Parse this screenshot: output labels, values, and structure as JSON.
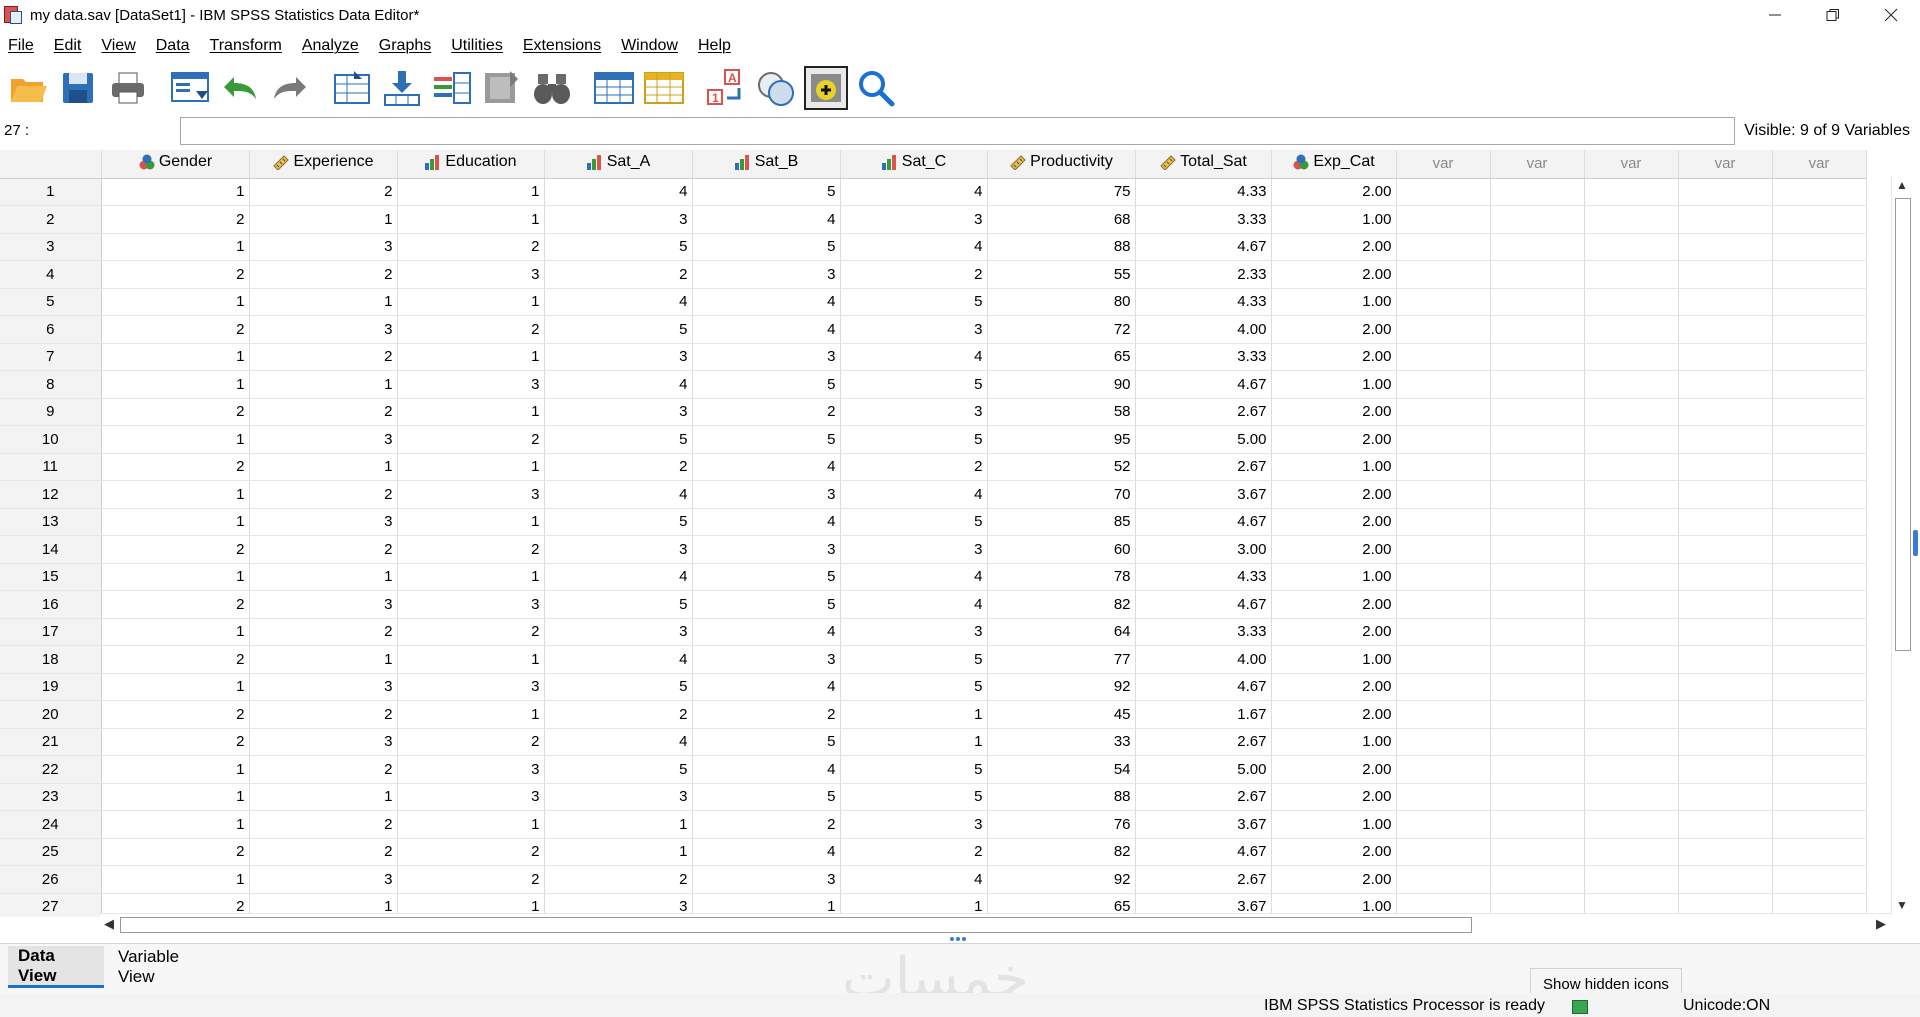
{
  "window": {
    "title": "my data.sav [DataSet1] - IBM SPSS Statistics Data Editor*",
    "controls": [
      "minimize",
      "restore",
      "close"
    ]
  },
  "menu": [
    "File",
    "Edit",
    "View",
    "Data",
    "Transform",
    "Analyze",
    "Graphs",
    "Utilities",
    "Extensions",
    "Window",
    "Help"
  ],
  "toolbar": {
    "buttons": [
      {
        "name": "open-icon"
      },
      {
        "name": "save-icon"
      },
      {
        "name": "print-icon"
      },
      {
        "name": "recall-dialog-icon"
      },
      {
        "name": "undo-icon"
      },
      {
        "name": "redo-icon"
      },
      {
        "name": "goto-case-icon"
      },
      {
        "name": "goto-variable-icon"
      },
      {
        "name": "variables-icon"
      },
      {
        "name": "run-descriptives-icon"
      },
      {
        "name": "find-icon"
      },
      {
        "name": "insert-cases-icon"
      },
      {
        "name": "insert-variable-icon"
      },
      {
        "name": "value-labels-icon"
      },
      {
        "name": "use-variable-sets-icon"
      },
      {
        "name": "show-all-variables-icon"
      },
      {
        "name": "spelling-icon"
      }
    ]
  },
  "cell_editor": {
    "ref": "27 :",
    "value": ""
  },
  "visible_info": "Visible: 9 of 9 Variables",
  "columns": [
    {
      "name": "Gender",
      "type": "nominal"
    },
    {
      "name": "Experience",
      "type": "scale"
    },
    {
      "name": "Education",
      "type": "ordinal"
    },
    {
      "name": "Sat_A",
      "type": "ordinal"
    },
    {
      "name": "Sat_B",
      "type": "ordinal"
    },
    {
      "name": "Sat_C",
      "type": "ordinal"
    },
    {
      "name": "Productivity",
      "type": "scale"
    },
    {
      "name": "Total_Sat",
      "type": "scale"
    },
    {
      "name": "Exp_Cat",
      "type": "nominal"
    }
  ],
  "empty_columns": [
    "var",
    "var",
    "var",
    "var",
    "var"
  ],
  "rows": [
    [
      "1",
      "1",
      "2",
      "1",
      "4",
      "5",
      "4",
      "75",
      "4.33",
      "2.00"
    ],
    [
      "2",
      "2",
      "1",
      "1",
      "3",
      "4",
      "3",
      "68",
      "3.33",
      "1.00"
    ],
    [
      "3",
      "1",
      "3",
      "2",
      "5",
      "5",
      "4",
      "88",
      "4.67",
      "2.00"
    ],
    [
      "4",
      "2",
      "2",
      "3",
      "2",
      "3",
      "2",
      "55",
      "2.33",
      "2.00"
    ],
    [
      "5",
      "1",
      "1",
      "1",
      "4",
      "4",
      "5",
      "80",
      "4.33",
      "1.00"
    ],
    [
      "6",
      "2",
      "3",
      "2",
      "5",
      "4",
      "3",
      "72",
      "4.00",
      "2.00"
    ],
    [
      "7",
      "1",
      "2",
      "1",
      "3",
      "3",
      "4",
      "65",
      "3.33",
      "2.00"
    ],
    [
      "8",
      "1",
      "1",
      "3",
      "4",
      "5",
      "5",
      "90",
      "4.67",
      "1.00"
    ],
    [
      "9",
      "2",
      "2",
      "1",
      "3",
      "2",
      "3",
      "58",
      "2.67",
      "2.00"
    ],
    [
      "10",
      "1",
      "3",
      "2",
      "5",
      "5",
      "5",
      "95",
      "5.00",
      "2.00"
    ],
    [
      "11",
      "2",
      "1",
      "1",
      "2",
      "4",
      "2",
      "52",
      "2.67",
      "1.00"
    ],
    [
      "12",
      "1",
      "2",
      "3",
      "4",
      "3",
      "4",
      "70",
      "3.67",
      "2.00"
    ],
    [
      "13",
      "1",
      "3",
      "1",
      "5",
      "4",
      "5",
      "85",
      "4.67",
      "2.00"
    ],
    [
      "14",
      "2",
      "2",
      "2",
      "3",
      "3",
      "3",
      "60",
      "3.00",
      "2.00"
    ],
    [
      "15",
      "1",
      "1",
      "1",
      "4",
      "5",
      "4",
      "78",
      "4.33",
      "1.00"
    ],
    [
      "16",
      "2",
      "3",
      "3",
      "5",
      "5",
      "4",
      "82",
      "4.67",
      "2.00"
    ],
    [
      "17",
      "1",
      "2",
      "2",
      "3",
      "4",
      "3",
      "64",
      "3.33",
      "2.00"
    ],
    [
      "18",
      "2",
      "1",
      "1",
      "4",
      "3",
      "5",
      "77",
      "4.00",
      "1.00"
    ],
    [
      "19",
      "1",
      "3",
      "3",
      "5",
      "4",
      "5",
      "92",
      "4.67",
      "2.00"
    ],
    [
      "20",
      "2",
      "2",
      "1",
      "2",
      "2",
      "1",
      "45",
      "1.67",
      "2.00"
    ],
    [
      "21",
      "2",
      "3",
      "2",
      "4",
      "5",
      "1",
      "33",
      "2.67",
      "1.00"
    ],
    [
      "22",
      "1",
      "2",
      "3",
      "5",
      "4",
      "5",
      "54",
      "5.00",
      "2.00"
    ],
    [
      "23",
      "1",
      "1",
      "3",
      "3",
      "5",
      "5",
      "88",
      "2.67",
      "2.00"
    ],
    [
      "24",
      "1",
      "2",
      "1",
      "1",
      "2",
      "3",
      "76",
      "3.67",
      "1.00"
    ],
    [
      "25",
      "2",
      "2",
      "2",
      "1",
      "4",
      "2",
      "82",
      "4.67",
      "2.00"
    ],
    [
      "26",
      "1",
      "3",
      "2",
      "2",
      "3",
      "4",
      "92",
      "2.67",
      "2.00"
    ],
    [
      "27",
      "2",
      "1",
      "1",
      "3",
      "1",
      "1",
      "65",
      "3.67",
      "1.00"
    ]
  ],
  "tabs": {
    "data_view": "Data View",
    "variable_view": "Variable View",
    "active": "data_view"
  },
  "watermark": "خمسات",
  "tooltip": "Show hidden icons",
  "status": {
    "processor": "IBM SPSS Statistics Processor is ready",
    "unicode": "Unicode:ON"
  }
}
